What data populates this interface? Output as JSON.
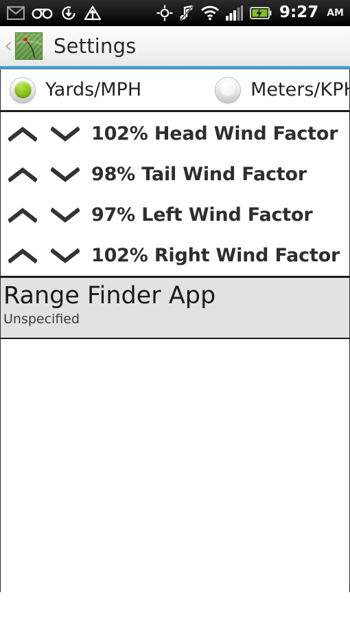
{
  "statusbar": {
    "icons_left": [
      {
        "name": "gmail-icon",
        "label": "Gmail"
      },
      {
        "name": "voicemail-icon",
        "label": "Voicemail"
      },
      {
        "name": "download-sync-icon",
        "label": "Download"
      },
      {
        "name": "warning-upload-icon",
        "label": "Warning"
      }
    ],
    "icons_right": [
      {
        "name": "gps-icon",
        "label": "GPS"
      },
      {
        "name": "music-muted-icon",
        "label": "Music muted"
      },
      {
        "name": "wifi-icon",
        "label": "Wi-Fi"
      },
      {
        "name": "signal-bars-icon",
        "label": "Signal"
      },
      {
        "name": "battery-charging-icon",
        "label": "Battery charging"
      }
    ],
    "time": "9:27",
    "meridiem": "AM"
  },
  "titlebar": {
    "back_label": "‹",
    "app_icon_name": "range-finder-app-icon",
    "title": "Settings"
  },
  "units": {
    "options": [
      {
        "label": "Yards/MPH",
        "selected": true
      },
      {
        "label": "Meters/KPH",
        "selected": false
      }
    ]
  },
  "wind_factors": [
    {
      "label": "102% Head Wind Factor",
      "value": "102%",
      "name": "head-wind-factor"
    },
    {
      "label": "98% Tail Wind Factor",
      "value": "98%",
      "name": "tail-wind-factor"
    },
    {
      "label": "97% Left Wind Factor",
      "value": "97%",
      "name": "left-wind-factor"
    },
    {
      "label": "102% Right Wind Factor",
      "value": "102%",
      "name": "right-wind-factor"
    }
  ],
  "banner": {
    "title": "Range Finder App",
    "subtitle": "Unspecified"
  },
  "colors": {
    "accent_rule": "#1aa6e0",
    "radio_selected": "#8fc923",
    "banner_bg": "#e2e2e2",
    "statusbar_bg": "#111111"
  }
}
